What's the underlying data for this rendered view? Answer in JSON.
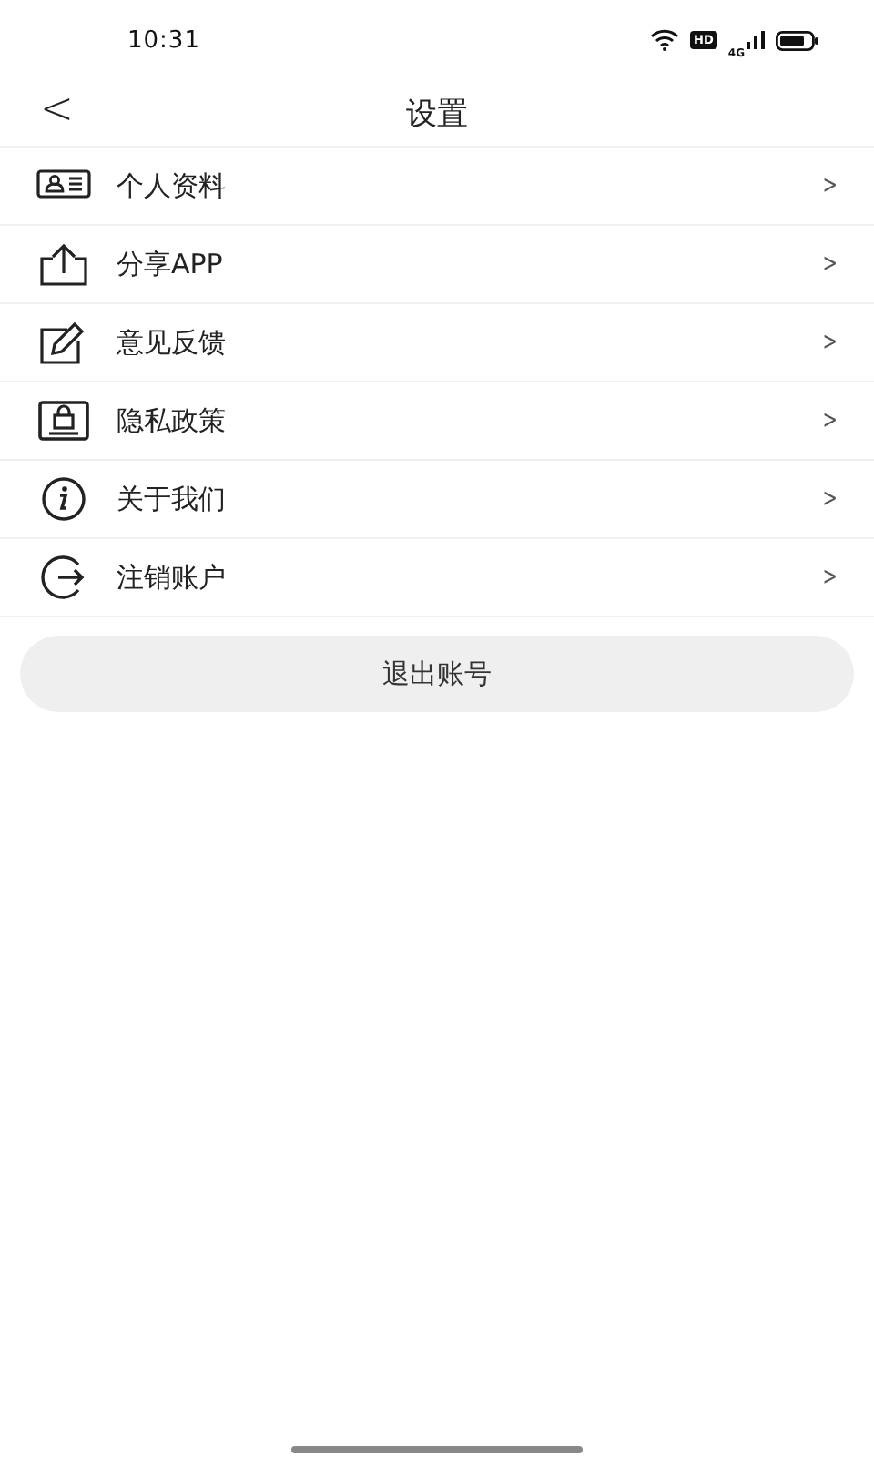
{
  "status_bar": {
    "time": "10:31",
    "hd": "HD",
    "network": "4G"
  },
  "header": {
    "back": "<",
    "title": "设置"
  },
  "menu": [
    {
      "kind": "profile",
      "label": "个人资料",
      "chevron": ">"
    },
    {
      "kind": "share",
      "label": "分享APP",
      "chevron": ">"
    },
    {
      "kind": "edit",
      "label": "意见反馈",
      "chevron": ">"
    },
    {
      "kind": "privacy",
      "label": "隐私政策",
      "chevron": ">"
    },
    {
      "kind": "info",
      "label": "关于我们",
      "chevron": ">"
    },
    {
      "kind": "logout",
      "label": "注销账户",
      "chevron": ">"
    }
  ],
  "logout_button": "退出账号"
}
